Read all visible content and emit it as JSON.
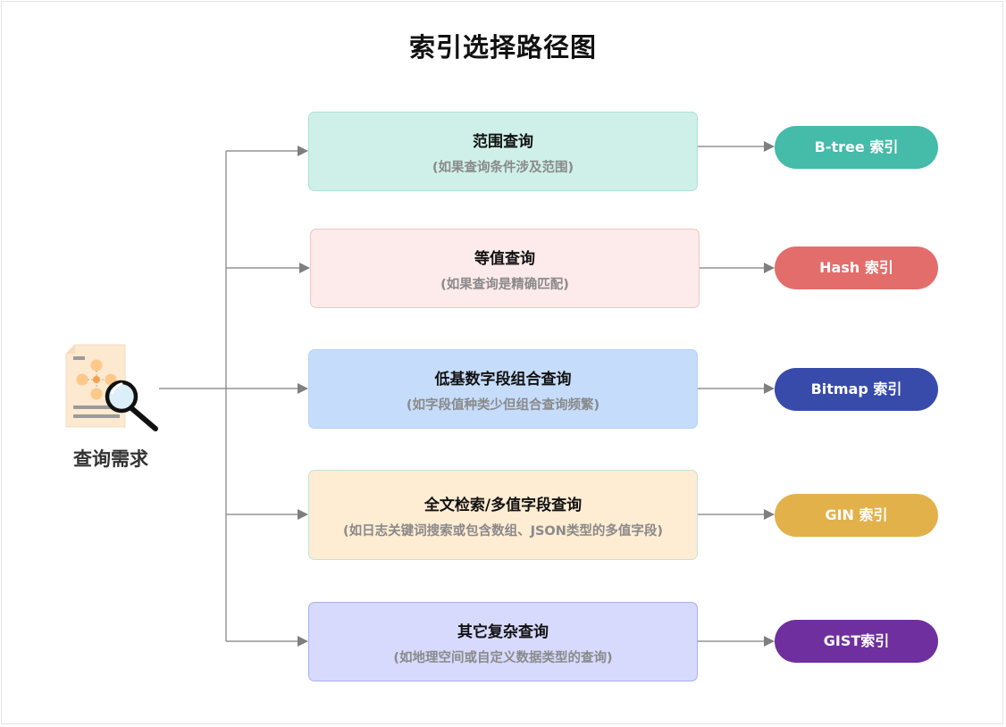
{
  "title": "索引选择路径图",
  "source": {
    "label": "查询需求",
    "icon": "document-search-icon"
  },
  "branches": [
    {
      "heading": "范围查询",
      "subtitle": "(如果查询条件涉及范围)",
      "index": "B-tree 索引",
      "box_fill": "#cff0e9",
      "box_border": "#a9e2d6",
      "pill_color": "#45bba9"
    },
    {
      "heading": "等值查询",
      "subtitle": "(如果查询是精确匹配)",
      "index": "Hash 索引",
      "box_fill": "#fdeaea",
      "box_border": "#f5c4c4",
      "pill_color": "#e36d6b"
    },
    {
      "heading": "低基数字段组合查询",
      "subtitle": "(如字段值种类少但组合查询频繁)",
      "index": "Bitmap 索引",
      "box_fill": "#c5dcfb",
      "box_border": "#b9d2f3",
      "pill_color": "#384bab"
    },
    {
      "heading": "全文检索/多值字段查询",
      "subtitle": "(如日志关键词搜索或包含数组、JSON类型的多值字段)",
      "index": "GIN 索引",
      "box_fill": "#feecd3",
      "box_border": "#bde6da",
      "pill_color": "#e2b14a"
    },
    {
      "heading": "其它复杂查询",
      "subtitle": "(如地理空间或自定义数据类型的查询)",
      "index": "GIST索引",
      "box_fill": "#d7dafd",
      "box_border": "#a8b0f2",
      "pill_color": "#6f2f9e"
    }
  ],
  "colors": {
    "connector": "#7f7f7f"
  }
}
